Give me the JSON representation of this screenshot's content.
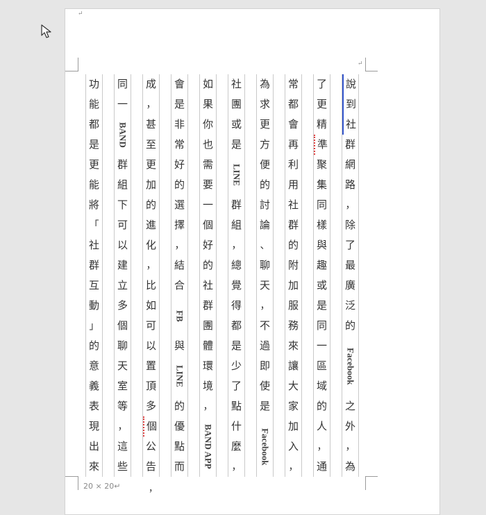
{
  "document": {
    "top_mark": "↵",
    "right_mark": "↵",
    "grid_size": "20 × 20↵",
    "trailing_punct": "，",
    "columns": [
      [
        {
          "t": "說"
        },
        {
          "t": "到"
        },
        {
          "t": "社"
        },
        {
          "t": "群"
        },
        {
          "t": "網"
        },
        {
          "t": "路"
        },
        {
          "t": "，"
        },
        {
          "t": "除"
        },
        {
          "t": "了"
        },
        {
          "t": "最"
        },
        {
          "t": "廣"
        },
        {
          "t": "泛"
        },
        {
          "t": "的"
        },
        {
          "t": "Facebook",
          "rot": 3
        },
        {
          "t": "之"
        },
        {
          "t": "外"
        },
        {
          "t": "，"
        },
        {
          "t": "為"
        }
      ],
      [
        {
          "t": "了"
        },
        {
          "t": "更"
        },
        {
          "t": "精"
        },
        {
          "t": "準"
        },
        {
          "t": "聚"
        },
        {
          "t": "集"
        },
        {
          "t": "同"
        },
        {
          "t": "樣"
        },
        {
          "t": "與"
        },
        {
          "t": "趣"
        },
        {
          "t": "或"
        },
        {
          "t": "是"
        },
        {
          "t": "同"
        },
        {
          "t": "一"
        },
        {
          "t": "區"
        },
        {
          "t": "域"
        },
        {
          "t": "的"
        },
        {
          "t": "人"
        },
        {
          "t": "，"
        },
        {
          "t": "通"
        }
      ],
      [
        {
          "t": "常"
        },
        {
          "t": "都"
        },
        {
          "t": "會"
        },
        {
          "t": "再"
        },
        {
          "t": "利"
        },
        {
          "t": "用"
        },
        {
          "t": "社"
        },
        {
          "t": "群"
        },
        {
          "t": "的"
        },
        {
          "t": "附"
        },
        {
          "t": "加"
        },
        {
          "t": "服"
        },
        {
          "t": "務"
        },
        {
          "t": "來"
        },
        {
          "t": "讓"
        },
        {
          "t": "大"
        },
        {
          "t": "家"
        },
        {
          "t": "加"
        },
        {
          "t": "入"
        },
        {
          "t": "，"
        }
      ],
      [
        {
          "t": "為"
        },
        {
          "t": "求"
        },
        {
          "t": "更"
        },
        {
          "t": "方"
        },
        {
          "t": "便"
        },
        {
          "t": "的"
        },
        {
          "t": "討"
        },
        {
          "t": "論"
        },
        {
          "t": "、"
        },
        {
          "t": "聊"
        },
        {
          "t": "天"
        },
        {
          "t": "，"
        },
        {
          "t": "不"
        },
        {
          "t": "過"
        },
        {
          "t": "即"
        },
        {
          "t": "使"
        },
        {
          "t": "是"
        },
        {
          "t": "Facebook",
          "rot": 3
        }
      ],
      [
        {
          "t": "社"
        },
        {
          "t": "團"
        },
        {
          "t": "或"
        },
        {
          "t": "是"
        },
        {
          "t": "LINE",
          "rot": 2
        },
        {
          "t": "群"
        },
        {
          "t": "組"
        },
        {
          "t": "，"
        },
        {
          "t": "總"
        },
        {
          "t": "覺"
        },
        {
          "t": "得"
        },
        {
          "t": "都"
        },
        {
          "t": "是"
        },
        {
          "t": "少"
        },
        {
          "t": "了"
        },
        {
          "t": "點"
        },
        {
          "t": "什"
        },
        {
          "t": "麼"
        },
        {
          "t": "，"
        }
      ],
      [
        {
          "t": "如"
        },
        {
          "t": "果"
        },
        {
          "t": "你"
        },
        {
          "t": "也"
        },
        {
          "t": "需"
        },
        {
          "t": "要"
        },
        {
          "t": "一"
        },
        {
          "t": "個"
        },
        {
          "t": "好"
        },
        {
          "t": "的"
        },
        {
          "t": "社"
        },
        {
          "t": "群"
        },
        {
          "t": "團"
        },
        {
          "t": "體"
        },
        {
          "t": "環"
        },
        {
          "t": "境"
        },
        {
          "t": "，"
        },
        {
          "t": "BAND APP",
          "rot": 3
        }
      ],
      [
        {
          "t": "會"
        },
        {
          "t": "是"
        },
        {
          "t": "非"
        },
        {
          "t": "常"
        },
        {
          "t": "好"
        },
        {
          "t": "的"
        },
        {
          "t": "選"
        },
        {
          "t": "擇"
        },
        {
          "t": "，"
        },
        {
          "t": "結"
        },
        {
          "t": "合"
        },
        {
          "t": "FB",
          "rot": 2
        },
        {
          "t": "與"
        },
        {
          "t": "LINE",
          "rot": 2
        },
        {
          "t": "的"
        },
        {
          "t": "優"
        },
        {
          "t": "點"
        },
        {
          "t": "而"
        }
      ],
      [
        {
          "t": "成"
        },
        {
          "t": "，"
        },
        {
          "t": "甚"
        },
        {
          "t": "至"
        },
        {
          "t": "更"
        },
        {
          "t": "加"
        },
        {
          "t": "的"
        },
        {
          "t": "進"
        },
        {
          "t": "化"
        },
        {
          "t": "，"
        },
        {
          "t": "比"
        },
        {
          "t": "如"
        },
        {
          "t": "可"
        },
        {
          "t": "以"
        },
        {
          "t": "置"
        },
        {
          "t": "頂"
        },
        {
          "t": "多"
        },
        {
          "t": "個"
        },
        {
          "t": "公"
        },
        {
          "t": "告"
        }
      ],
      [
        {
          "t": "同"
        },
        {
          "t": "一"
        },
        {
          "t": "BAND",
          "rot": 2
        },
        {
          "t": "群"
        },
        {
          "t": "組"
        },
        {
          "t": "下"
        },
        {
          "t": "可"
        },
        {
          "t": "以"
        },
        {
          "t": "建"
        },
        {
          "t": "立"
        },
        {
          "t": "多"
        },
        {
          "t": "個"
        },
        {
          "t": "聊"
        },
        {
          "t": "天"
        },
        {
          "t": "室"
        },
        {
          "t": "等"
        },
        {
          "t": "，"
        },
        {
          "t": "這"
        },
        {
          "t": "些"
        }
      ],
      [
        {
          "t": "功"
        },
        {
          "t": "能"
        },
        {
          "t": "都"
        },
        {
          "t": "是"
        },
        {
          "t": "更"
        },
        {
          "t": "能"
        },
        {
          "t": "將"
        },
        {
          "t": "「"
        },
        {
          "t": "社"
        },
        {
          "t": "群"
        },
        {
          "t": "互"
        },
        {
          "t": "動"
        },
        {
          "t": "」"
        },
        {
          "t": "的"
        },
        {
          "t": "意"
        },
        {
          "t": "義"
        },
        {
          "t": "表"
        },
        {
          "t": "現"
        },
        {
          "t": "出"
        },
        {
          "t": "來"
        }
      ]
    ]
  }
}
